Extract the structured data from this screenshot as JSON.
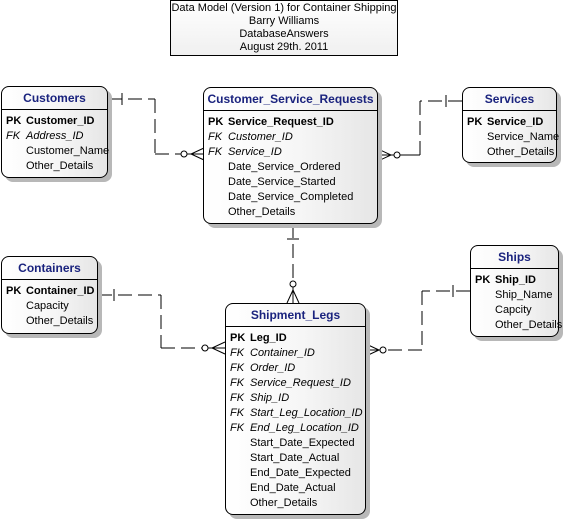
{
  "title_block": {
    "lines": [
      "Data Model (Version 1) for Container Shipping",
      "Barry Williams",
      "DatabaseAnswers",
      "August 29th. 2011"
    ]
  },
  "colors": {
    "header_text": "#1a237e",
    "border": "#000000",
    "shadow": "#b8b8b8"
  },
  "entities": {
    "customers": {
      "name": "Customers",
      "attributes": [
        {
          "key": "PK",
          "name": "Customer_ID"
        },
        {
          "key": "FK",
          "name": "Address_ID"
        },
        {
          "key": "",
          "name": "Customer_Name"
        },
        {
          "key": "",
          "name": "Other_Details"
        }
      ]
    },
    "customer_service_requests": {
      "name": "Customer_Service_Requests",
      "attributes": [
        {
          "key": "PK",
          "name": "Service_Request_ID"
        },
        {
          "key": "FK",
          "name": "Customer_ID"
        },
        {
          "key": "FK",
          "name": "Service_ID"
        },
        {
          "key": "",
          "name": "Date_Service_Ordered"
        },
        {
          "key": "",
          "name": "Date_Service_Started"
        },
        {
          "key": "",
          "name": "Date_Service_Completed"
        },
        {
          "key": "",
          "name": "Other_Details"
        }
      ]
    },
    "services": {
      "name": "Services",
      "attributes": [
        {
          "key": "PK",
          "name": "Service_ID"
        },
        {
          "key": "",
          "name": "Service_Name"
        },
        {
          "key": "",
          "name": "Other_Details"
        }
      ]
    },
    "containers": {
      "name": "Containers",
      "attributes": [
        {
          "key": "PK",
          "name": "Container_ID"
        },
        {
          "key": "",
          "name": "Capacity"
        },
        {
          "key": "",
          "name": "Other_Details"
        }
      ]
    },
    "shipment_legs": {
      "name": "Shipment_Legs",
      "attributes": [
        {
          "key": "PK",
          "name": "Leg_ID"
        },
        {
          "key": "FK",
          "name": "Container_ID"
        },
        {
          "key": "FK",
          "name": "Order_ID"
        },
        {
          "key": "FK",
          "name": "Service_Request_ID"
        },
        {
          "key": "FK",
          "name": "Ship_ID"
        },
        {
          "key": "FK",
          "name": "Start_Leg_Location_ID"
        },
        {
          "key": "FK",
          "name": "End_Leg_Location_ID"
        },
        {
          "key": "",
          "name": "Start_Date_Expected"
        },
        {
          "key": "",
          "name": "Start_Date_Actual"
        },
        {
          "key": "",
          "name": "End_Date_Expected"
        },
        {
          "key": "",
          "name": "End_Date_Actual"
        },
        {
          "key": "",
          "name": "Other_Details"
        }
      ]
    },
    "ships": {
      "name": "Ships",
      "attributes": [
        {
          "key": "PK",
          "name": "Ship_ID"
        },
        {
          "key": "",
          "name": "Ship_Name"
        },
        {
          "key": "",
          "name": "Capcity"
        },
        {
          "key": "",
          "name": "Other_Details"
        }
      ]
    }
  },
  "relationships": [
    {
      "from": "Customers",
      "to": "Customer_Service_Requests",
      "from_end": "one",
      "to_end": "zero-or-many"
    },
    {
      "from": "Services",
      "to": "Customer_Service_Requests",
      "from_end": "one",
      "to_end": "zero-or-many"
    },
    {
      "from": "Customer_Service_Requests",
      "to": "Shipment_Legs",
      "from_end": "one",
      "to_end": "zero-or-many"
    },
    {
      "from": "Containers",
      "to": "Shipment_Legs",
      "from_end": "one",
      "to_end": "zero-or-many"
    },
    {
      "from": "Ships",
      "to": "Shipment_Legs",
      "from_end": "one",
      "to_end": "zero-or-many"
    }
  ]
}
